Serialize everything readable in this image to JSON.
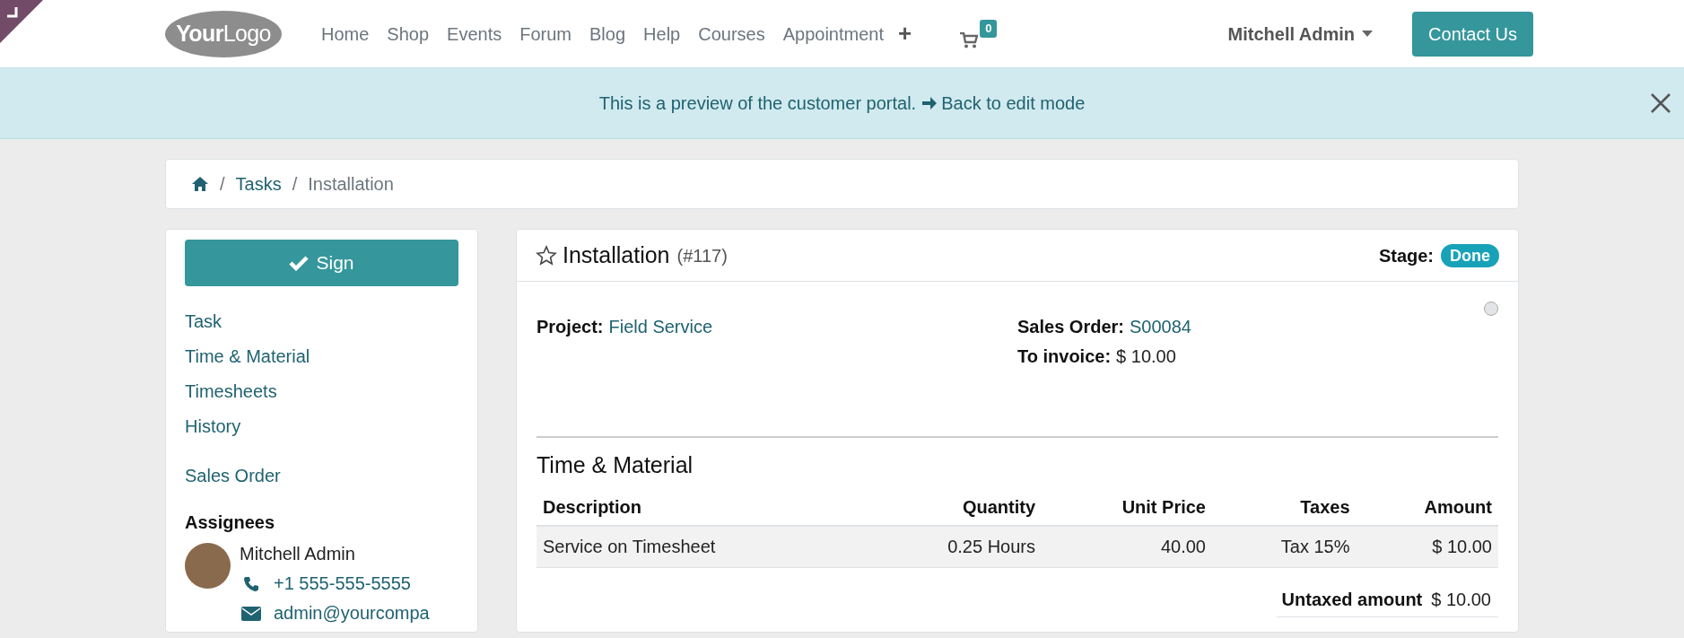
{
  "header": {
    "logo": "**Your**Logo",
    "nav": [
      "Home",
      "Shop",
      "Events",
      "Forum",
      "Blog",
      "Help",
      "Courses",
      "Appointment"
    ],
    "add_symbol": "+",
    "cart_count": "0",
    "user": "Mitchell Admin",
    "contact_button": "Contact Us"
  },
  "preview_banner": {
    "message": "This is a preview of the customer portal.",
    "link": "Back to edit mode"
  },
  "breadcrumb": {
    "separator": "/",
    "items": [
      "Tasks",
      "Installation"
    ]
  },
  "sidebar": {
    "sign_button": "Sign",
    "links": [
      "Task",
      "Time & Material",
      "Timesheets",
      "History"
    ],
    "sales_order_link": "Sales Order",
    "assignees_title": "Assignees",
    "assignee": {
      "name": "Mitchell Admin",
      "phone": "+1 555-555-5555",
      "email": "admin@yourcompa"
    }
  },
  "task": {
    "title": "Installation",
    "number": "(#117)",
    "stage_label": "Stage:",
    "stage": "Done",
    "fields": [
      {
        "label": "Project:",
        "value": "Field Service",
        "link": true
      },
      {
        "label": "Sales Order:",
        "value": "S00084",
        "link": true
      },
      {
        "label": "To invoice:",
        "value": "$ 10.00",
        "link": false
      }
    ],
    "section_title": "Time & Material",
    "table": {
      "columns": [
        "Description",
        "Quantity",
        "Unit Price",
        "Taxes",
        "Amount"
      ],
      "rows": [
        [
          "Service on Timesheet",
          "0.25 Hours",
          "40.00",
          "Tax 15%",
          "$ 10.00"
        ]
      ]
    },
    "untaxed_label": "Untaxed amount",
    "untaxed_value": "$ 10.00"
  }
}
